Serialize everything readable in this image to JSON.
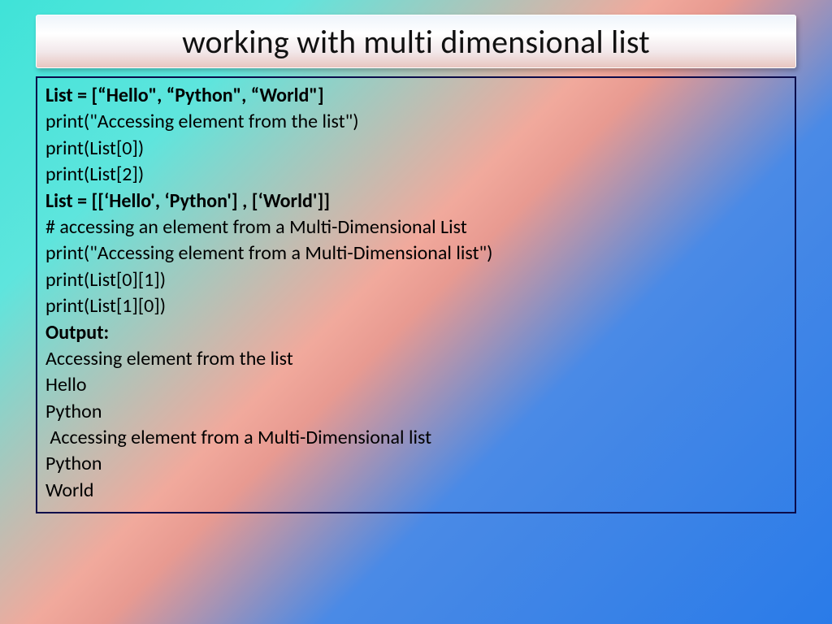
{
  "title": "working with multi dimensional list",
  "lines": {
    "l0": "List = [“Hello\", “Python\", “World\"]",
    "l1": "print(\"Accessing element from the list\")",
    "l2": "print(List[0])",
    "l3": "print(List[2])",
    "l4": "List = [[‘Hello', ‘Python'] , [‘World']]",
    "l5": "# accessing an element from a Multi-Dimensional List",
    "l6": "print(\"Accessing element from a Multi-Dimensional list\")",
    "l7": "print(List[0][1])",
    "l8": "print(List[1][0])",
    "l9": "Output:",
    "l10": "Accessing element from the list",
    "l11": "Hello",
    "l12": "Python",
    "l13": " Accessing element from a Multi-Dimensional list",
    "l14": "Python",
    "l15": "World"
  }
}
